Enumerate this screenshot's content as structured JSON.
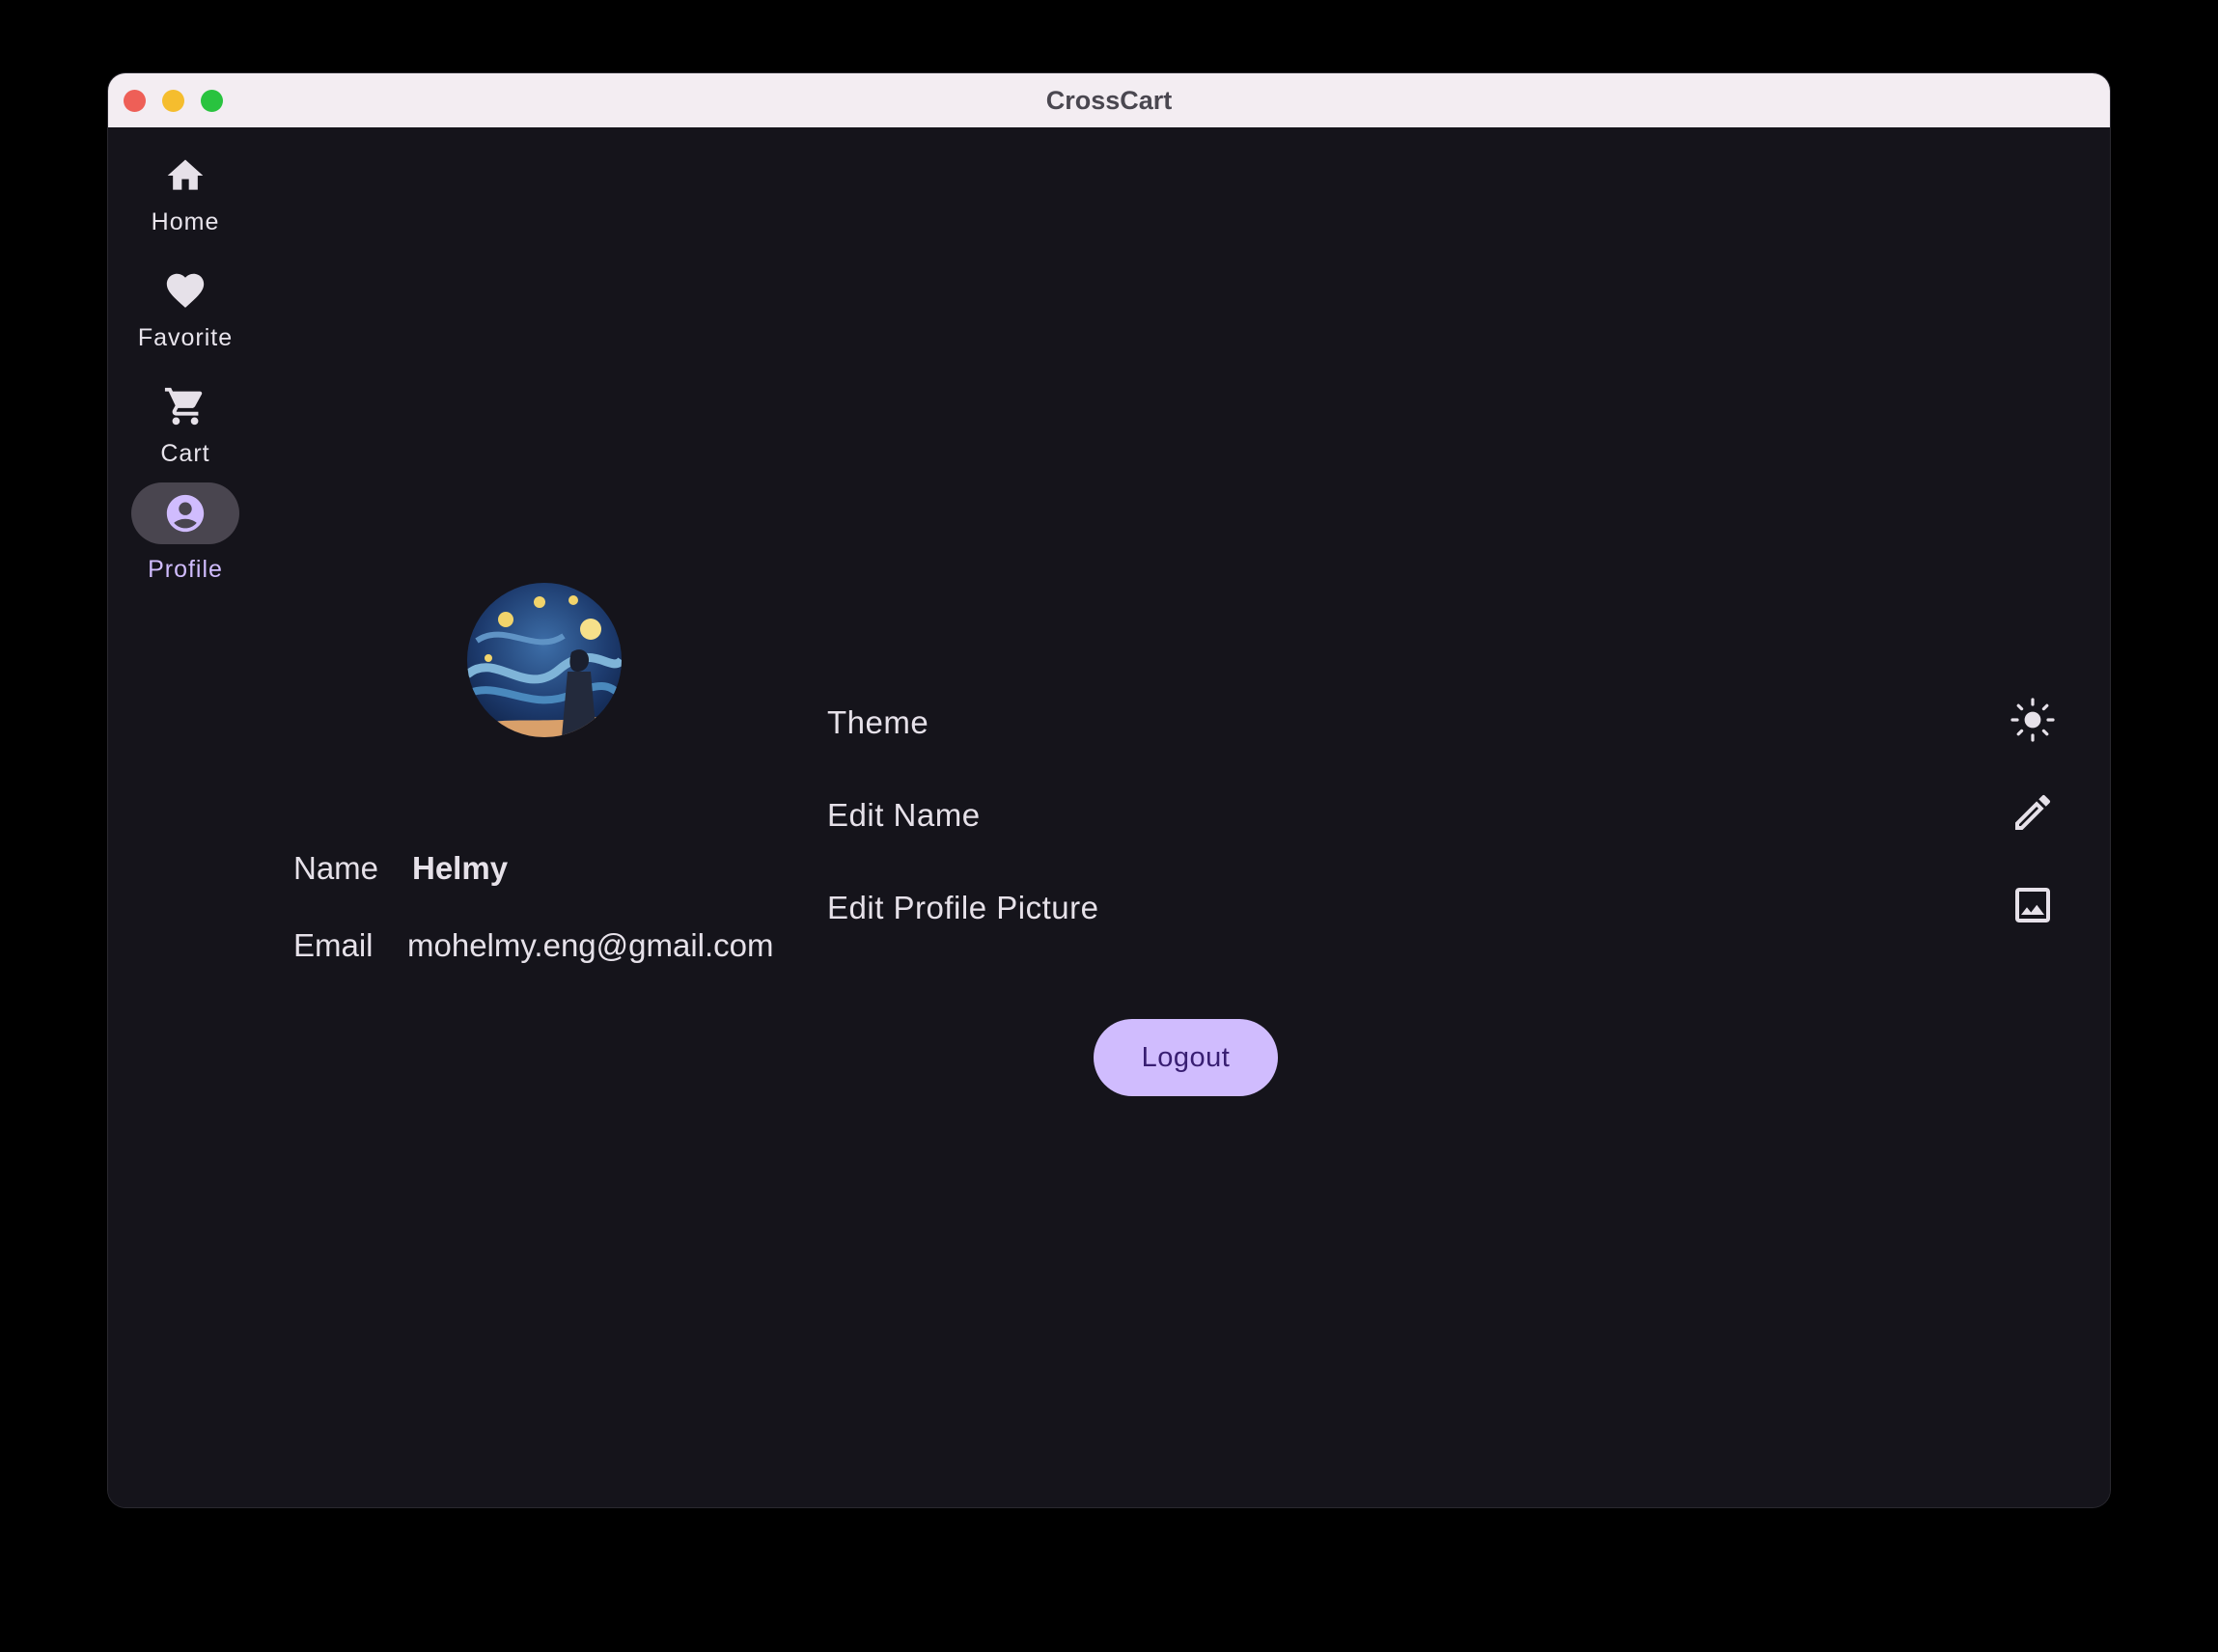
{
  "window": {
    "title": "CrossCart"
  },
  "nav": {
    "items": [
      {
        "label": "Home",
        "icon": "home-icon"
      },
      {
        "label": "Favorite",
        "icon": "heart-icon"
      },
      {
        "label": "Cart",
        "icon": "cart-icon"
      },
      {
        "label": "Profile",
        "icon": "account-circle-icon",
        "selected": true
      }
    ]
  },
  "profile": {
    "avatar": "starry-night-avatar",
    "name_label": "Name",
    "name_value": "Helmy",
    "email_label": "Email",
    "email_value": "mohelmy.eng@gmail.com"
  },
  "settings": [
    {
      "label": "Theme",
      "icon": "sun-icon"
    },
    {
      "label": "Edit Name",
      "icon": "pencil-icon"
    },
    {
      "label": "Edit Profile Picture",
      "icon": "image-icon"
    }
  ],
  "actions": {
    "logout_label": "Logout"
  },
  "colors": {
    "background": "#15141b",
    "accent": "#d0bcfe",
    "accent_text": "#381e72",
    "selected_pill": "#49454f",
    "text": "#e6e1e9",
    "titlebar": "#f3edf2"
  }
}
